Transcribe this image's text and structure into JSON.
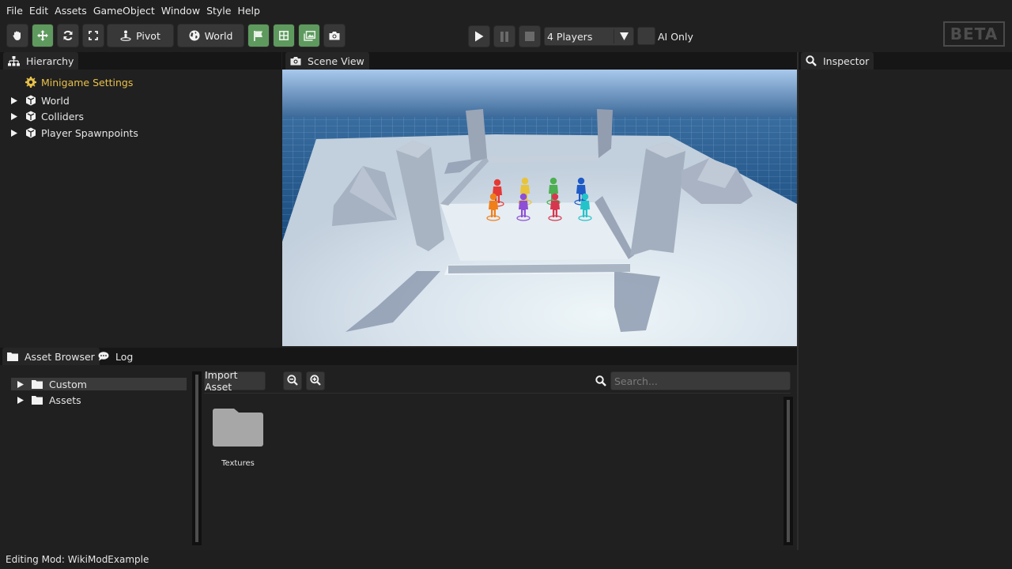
{
  "menubar": {
    "items": [
      "File",
      "Edit",
      "Assets",
      "GameObject",
      "Window",
      "Style",
      "Help"
    ]
  },
  "toolbar": {
    "tools": [
      {
        "name": "hand-tool",
        "icon": "hand-icon",
        "active": false
      },
      {
        "name": "move-tool",
        "icon": "move-arrows-icon",
        "active": true
      },
      {
        "name": "rotate-tool",
        "icon": "rotate-icon",
        "active": false
      },
      {
        "name": "scale-tool",
        "icon": "expand-icon",
        "active": false
      }
    ],
    "pivot_label": "Pivot",
    "world_label": "World",
    "toggles": [
      {
        "name": "flag-toggle",
        "icon": "flag-icon",
        "active": true
      },
      {
        "name": "grid-toggle",
        "icon": "grid-icon",
        "active": true
      },
      {
        "name": "images-toggle",
        "icon": "images-icon",
        "active": true
      },
      {
        "name": "screenshot-button",
        "icon": "camera-icon",
        "active": false
      }
    ],
    "players_select": "4 Players",
    "ai_only_label": "AI Only",
    "ai_only_checked": false,
    "beta_badge": "BETA"
  },
  "hierarchy": {
    "tab_label": "Hierarchy",
    "items": [
      {
        "label": "Minigame Settings",
        "icon": "gear-icon",
        "expandable": false
      },
      {
        "label": "World",
        "icon": "cube-icon",
        "expandable": true
      },
      {
        "label": "Colliders",
        "icon": "cube-icon",
        "expandable": true
      },
      {
        "label": "Player Spawnpoints",
        "icon": "cube-icon",
        "expandable": true
      }
    ]
  },
  "scene_view": {
    "tab_label": "Scene View",
    "players": [
      {
        "color": "#e53935"
      },
      {
        "color": "#e8c43a"
      },
      {
        "color": "#4caf50"
      },
      {
        "color": "#1e5bc6"
      },
      {
        "color": "#f07f1a"
      },
      {
        "color": "#8e4fd6"
      },
      {
        "color": "#d8364f"
      },
      {
        "color": "#23c4c9"
      }
    ]
  },
  "inspector": {
    "tab_label": "Inspector"
  },
  "bottom_panel": {
    "tabs": [
      {
        "label": "Asset Browser",
        "icon": "folder-icon",
        "active": true
      },
      {
        "label": "Log",
        "icon": "chat-icon",
        "active": false
      }
    ],
    "tree": [
      {
        "label": "Custom",
        "selected": true
      },
      {
        "label": "Assets",
        "selected": false
      }
    ],
    "import_label": "Import Asset",
    "search_placeholder": "Search...",
    "search_value": "",
    "assets": [
      {
        "label": "Textures",
        "type": "folder"
      }
    ]
  },
  "status_bar": {
    "text": "Editing Mod: WikiModExample"
  },
  "colors": {
    "accent_green": "#5e9a5e",
    "settings_yellow": "#e8c14a",
    "panel_bg": "#202020"
  }
}
